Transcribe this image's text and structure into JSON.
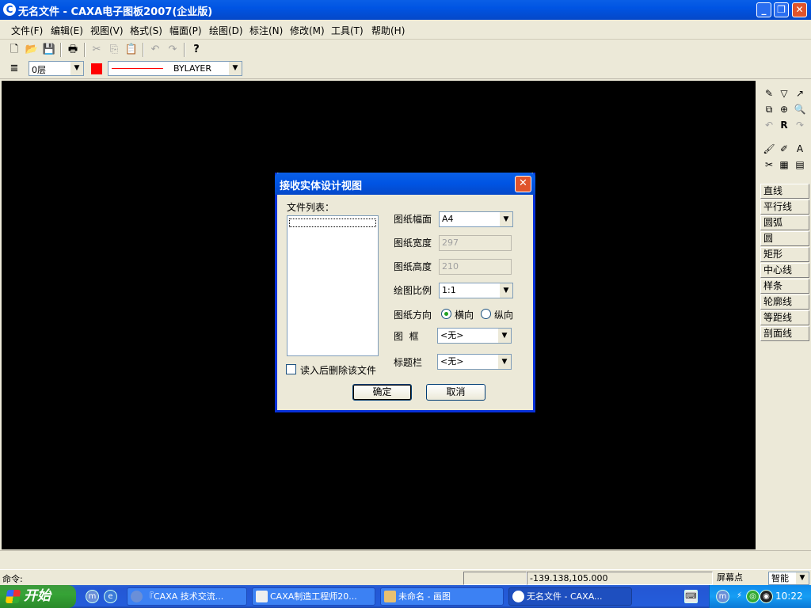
{
  "window": {
    "title": "无名文件 - CAXA电子图板2007(企业版)",
    "icon": "caxa-logo-icon"
  },
  "menubar": [
    "文件(F)",
    "编辑(E)",
    "视图(V)",
    "格式(S)",
    "幅面(P)",
    "绘图(D)",
    "标注(N)",
    "修改(M)",
    "工具(T)",
    "帮助(H)"
  ],
  "toolbar2": {
    "layer": "0层",
    "linetype": "BYLAYER",
    "color": "#ff0000"
  },
  "right_panel": {
    "draw_buttons": [
      "直线",
      "平行线",
      "圆弧",
      "圆",
      "矩形",
      "中心线",
      "样条",
      "轮廓线",
      "等距线",
      "剖面线"
    ]
  },
  "dialog": {
    "title": "接收实体设计视图",
    "file_list_label": "文件列表：",
    "paper_size_label": "图纸幅面",
    "paper_size_value": "A4",
    "paper_width_label": "图纸宽度",
    "paper_width_value": "297",
    "paper_height_label": "图纸高度",
    "paper_height_value": "210",
    "scale_label": "绘图比例",
    "scale_value": "1:1",
    "orientation_label": "图纸方向",
    "orientation_landscape": "横向",
    "orientation_portrait": "纵向",
    "frame_label": "图  框",
    "frame_value": "<无>",
    "titleblock_label": "标题栏",
    "titleblock_value": "<无>",
    "delete_after_read": "读入后删除该文件",
    "ok": "确定",
    "cancel": "取消"
  },
  "status": {
    "command_label": "命令:",
    "coords": "-139.138,105.000",
    "snap_mode_label": "屏幕点",
    "smart": "智能"
  },
  "taskbar": {
    "start": "开始",
    "tasks": [
      "『CAXA 技术交流...",
      "CAXA制造工程师20...",
      "未命名 - 画图",
      "无名文件 - CAXA..."
    ],
    "clock": "10:22"
  }
}
